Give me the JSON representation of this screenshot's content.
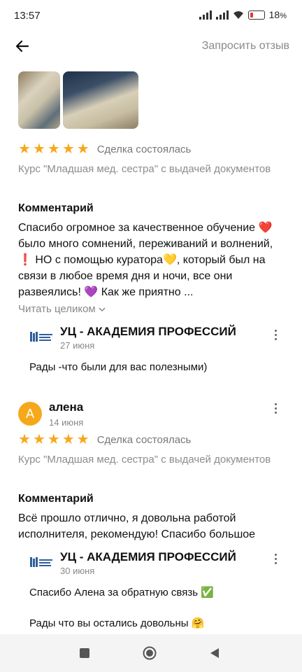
{
  "status": {
    "time": "13:57",
    "battery": "18",
    "battery_unit": "%"
  },
  "header": {
    "request_review": "Запросить отзыв"
  },
  "review1": {
    "rating": 5,
    "deal": "Сделка состоялась",
    "course": "Курс \"Младшая мед. сестра\" с выдачей документов",
    "comment_title": "Комментарий",
    "comment": "Спасибо огромное за качественное обучение ❤️ было много сомнений, переживаний и волнений, ❗ НО с помощью куратора💛, который был на связи в любое время дня и ночи, все они развеялись! 💜 Как же приятно ...",
    "read_more": "Читать целиком",
    "reply": {
      "author": "УЦ -  АКАДЕМИЯ ПРОФЕССИЙ",
      "date": "27 июня",
      "text": "Рады -что были для вас полезными)"
    }
  },
  "review2": {
    "avatar_letter": "А",
    "author": "алена",
    "date": "14 июня",
    "rating": 5,
    "deal": "Сделка состоялась",
    "course": "Курс \"Младшая мед. сестра\" с выдачей документов",
    "comment_title": "Комментарий",
    "comment": "Всё прошло отлично, я довольна работой исполнителя, рекомендую! Спасибо большое",
    "reply": {
      "author": "УЦ -  АКАДЕМИЯ ПРОФЕССИЙ",
      "date": "30 июня",
      "text": "Спасибо Алена за обратную связь ✅\n\nРады что вы остались довольны 🤗"
    }
  },
  "colors": {
    "star": "#f6a81b",
    "avatar": "#f6a81b",
    "muted": "#8c8c8c"
  }
}
